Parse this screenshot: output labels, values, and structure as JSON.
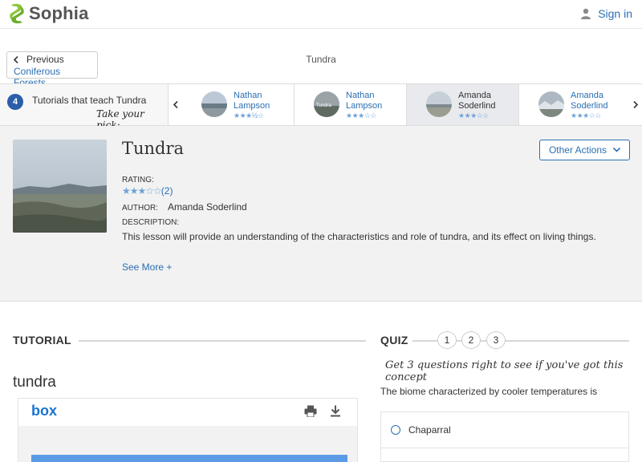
{
  "header": {
    "brand": "Sophia",
    "signin_label": "Sign in",
    "icons": {
      "logo": "sophia-s-logo-icon",
      "user": "user-icon"
    }
  },
  "breadcrumb": {
    "previous_label": "Previous",
    "previous_link": "Coniferous Forests",
    "current": "Tundra"
  },
  "tutorial_strip": {
    "count": "4",
    "label": "Tutorials that teach Tundra",
    "pick": "Take your pick:",
    "cards": [
      {
        "author": "Nathan Lampson",
        "stars": "★★★½☆",
        "active": false,
        "thumb_label": ""
      },
      {
        "author": "Nathan Lampson",
        "stars": "★★★☆☆",
        "active": false,
        "thumb_label": "Tundra"
      },
      {
        "author": "Amanda Soderlind",
        "stars": "★★★☆☆",
        "active": true,
        "thumb_label": ""
      },
      {
        "author": "Amanda Soderlind",
        "stars": "★★★☆☆",
        "active": false,
        "thumb_label": ""
      }
    ]
  },
  "lesson": {
    "title": "Tundra",
    "other_actions": "Other Actions",
    "rating_label": "RATING:",
    "rating_stars": "★★★☆☆",
    "rating_count": "(2)",
    "author_label": "AUTHOR:",
    "author": "Amanda Soderlind",
    "description_label": "DESCRIPTION:",
    "description": "This lesson will provide an understanding of the characteristics and role of tundra, and its effect on living things.",
    "see_more": "See More +"
  },
  "tutorial": {
    "heading": "TUTORIAL",
    "title": "tundra",
    "viewer_brand": "box"
  },
  "quiz": {
    "heading": "QUIZ",
    "steps": [
      "1",
      "2",
      "3"
    ],
    "challenge": "Get 3 questions right to see if you've got this concept",
    "question": "The biome characterized by cooler temperatures is",
    "answers": [
      "Chaparral"
    ]
  },
  "colors": {
    "link": "#2b6fb3",
    "brand_green": "#8cc63f",
    "badge": "#2a5ea8",
    "star": "#6fa3d8"
  }
}
